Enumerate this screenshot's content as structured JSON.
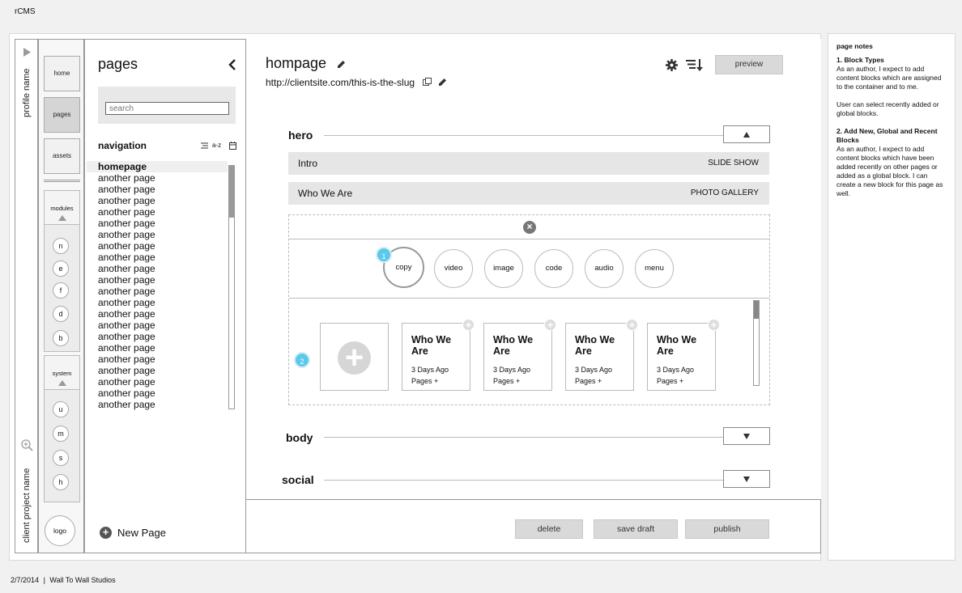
{
  "app": {
    "title": "rCMS"
  },
  "footer": {
    "date": "2/7/2014",
    "sep": "|",
    "studio": "Wall To Wall Studios"
  },
  "profile_rail": {
    "profile_name": "profile name",
    "project_name": "client project name"
  },
  "nav_rail": {
    "items": [
      "home",
      "pages",
      "assets"
    ],
    "modules": {
      "label": "modules",
      "items": [
        "n",
        "e",
        "f",
        "d",
        "b"
      ]
    },
    "system": {
      "label": "system",
      "items": [
        "u",
        "m",
        "s",
        "h"
      ]
    },
    "logo": "logo"
  },
  "pages_panel": {
    "title": "pages",
    "search_placeholder": "search",
    "navigation_label": "navigation",
    "sort_az": "a-z",
    "pages": [
      "homepage",
      "another page",
      "another page",
      "another page",
      "another page",
      "another page",
      "another page",
      "another page",
      "another page",
      "another page",
      "another page",
      "another page",
      "another page",
      "another page",
      "another page",
      "another page",
      "another page",
      "another page",
      "another page",
      "another page",
      "another page",
      "another page"
    ],
    "new_page": "New Page"
  },
  "editor": {
    "page_name": "hompage",
    "slug": "http://clientsite.com/this-is-the-slug",
    "preview": "preview",
    "sections": {
      "hero": "hero",
      "body": "body",
      "social": "social"
    },
    "blocks": [
      {
        "name": "Intro",
        "type": "SLIDE SHOW"
      },
      {
        "name": "Who We Are",
        "type": "PHOTO GALLERY"
      }
    ],
    "block_types": [
      "copy",
      "video",
      "image",
      "code",
      "audio",
      "menu"
    ],
    "badges": [
      "1",
      "2"
    ],
    "recent_blocks": [
      {
        "title": "Who We Are",
        "date": "3 Days Ago",
        "pages": "Pages +"
      },
      {
        "title": "Who We Are",
        "date": "3 Days Ago",
        "pages": "Pages +"
      },
      {
        "title": "Who We Are",
        "date": "3 Days Ago",
        "pages": "Pages +"
      },
      {
        "title": "Who We Are",
        "date": "3 Days Ago",
        "pages": "Pages +"
      }
    ],
    "actions": {
      "delete": "delete",
      "save_draft": "save draft",
      "publish": "publish"
    }
  },
  "notes": {
    "heading": "page notes",
    "items": [
      {
        "title": "1. Block Types",
        "body": "As an author, I expect to add content blocks which are assigned to the container and to me.",
        "extra": "User can select recently added or global blocks."
      },
      {
        "title": "2. Add New, Global and Recent Blocks",
        "body": "As an author, I expect to add content blocks which have been added recently on other pages or added as a global block. I can create a new block for this page as well."
      }
    ]
  }
}
